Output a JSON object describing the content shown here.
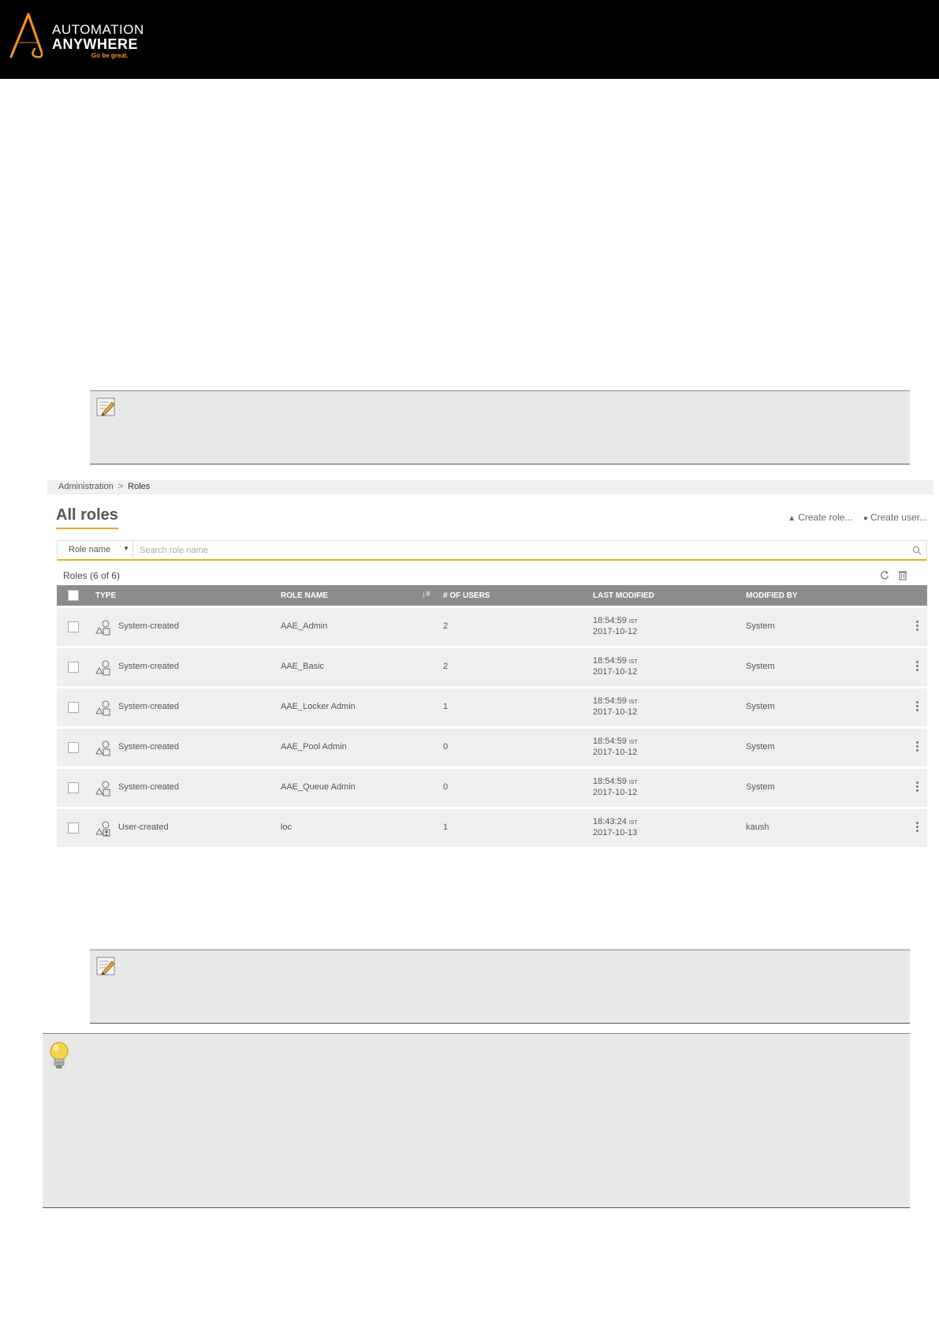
{
  "header": {
    "logo_line1": "AUTOMATION",
    "logo_line2": "ANYWHERE",
    "logo_tagline": "Go be great."
  },
  "app": {
    "breadcrumb": {
      "parent": "Administration",
      "separator": ">",
      "current": "Roles"
    },
    "page_title": "All roles",
    "actions": {
      "create_role": "Create role...",
      "create_user": "Create user..."
    },
    "search": {
      "filter_value": "Role name",
      "placeholder": "Search role name"
    },
    "roles_count": "Roles (6 of 6)",
    "columns": {
      "type": "TYPE",
      "role_name": "ROLE NAME",
      "users": "# OF USERS",
      "last_modified": "LAST MODIFIED",
      "modified_by": "MODIFIED BY"
    },
    "rows": [
      {
        "type": "System-created",
        "role_name": "AAE_Admin",
        "users": "2",
        "time": "18:54:59",
        "tz": "IST",
        "date": "2017-10-12",
        "modified_by": "System"
      },
      {
        "type": "System-created",
        "role_name": "AAE_Basic",
        "users": "2",
        "time": "18:54:59",
        "tz": "IST",
        "date": "2017-10-12",
        "modified_by": "System"
      },
      {
        "type": "System-created",
        "role_name": "AAE_Locker Admin",
        "users": "1",
        "time": "18:54:59",
        "tz": "IST",
        "date": "2017-10-12",
        "modified_by": "System"
      },
      {
        "type": "System-created",
        "role_name": "AAE_Pool Admin",
        "users": "0",
        "time": "18:54:59",
        "tz": "IST",
        "date": "2017-10-12",
        "modified_by": "System"
      },
      {
        "type": "System-created",
        "role_name": "AAE_Queue Admin",
        "users": "0",
        "time": "18:54:59",
        "tz": "IST",
        "date": "2017-10-12",
        "modified_by": "System"
      },
      {
        "type": "User-created",
        "role_name": "loc",
        "users": "1",
        "time": "18:43:24",
        "tz": "IST",
        "date": "2017-10-13",
        "modified_by": "kaush"
      }
    ]
  },
  "icons": {
    "logo": "automation-anywhere-logo",
    "note": "pencil-note-icon",
    "tip": "lightbulb-icon",
    "create_role": "roles-icon",
    "create_user": "user-icon",
    "search": "search-icon",
    "refresh": "refresh-icon",
    "delete": "trash-icon",
    "columns": "table-columns-icon",
    "sort": "sort-icon",
    "row_menu": "kebab-menu-icon"
  },
  "colors": {
    "header_bg": "#000000",
    "brand_orange": "#f7941d",
    "accent_underline": "#f5a623",
    "table_header_bg": "#8c8c8c",
    "row_bg": "#efefef",
    "note_bg": "#e8e8e8"
  }
}
